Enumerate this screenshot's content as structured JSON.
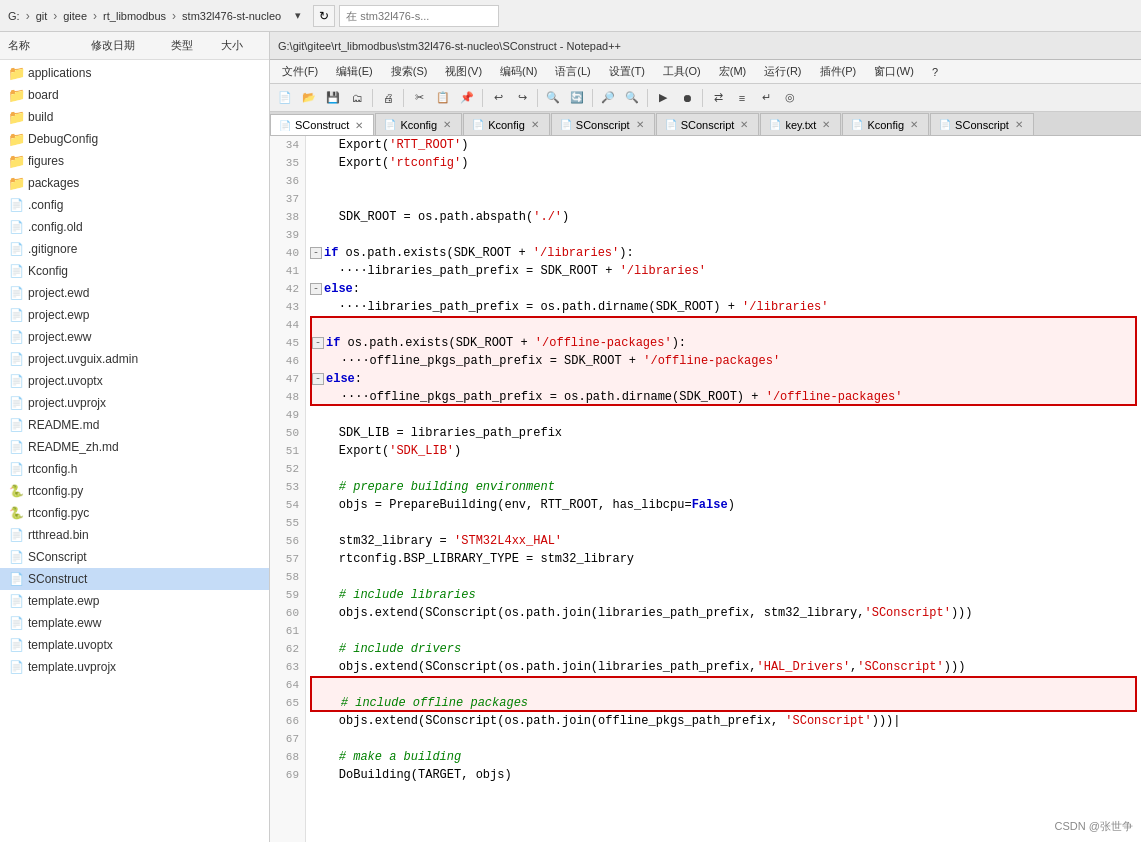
{
  "address_bar": {
    "parts": [
      "G:",
      "git",
      "gitee",
      "rt_libmodbus",
      "stm32l476-st-nucleo"
    ],
    "search_placeholder": "在 stm32l476-s..."
  },
  "sidebar": {
    "columns": [
      "名称",
      "修改日期",
      "类型",
      "大小"
    ],
    "items": [
      {
        "name": "applications",
        "type": "folder",
        "selected": false
      },
      {
        "name": "board",
        "type": "folder",
        "selected": false
      },
      {
        "name": "build",
        "type": "folder",
        "selected": false
      },
      {
        "name": "DebugConfig",
        "type": "folder",
        "selected": false
      },
      {
        "name": "figures",
        "type": "folder",
        "selected": false
      },
      {
        "name": "packages",
        "type": "folder",
        "selected": false
      },
      {
        "name": ".config",
        "type": "file-dot",
        "selected": false
      },
      {
        "name": ".config.old",
        "type": "file-dot",
        "selected": false
      },
      {
        "name": ".gitignore",
        "type": "file-dot",
        "selected": false
      },
      {
        "name": "Kconfig",
        "type": "file-green",
        "selected": false
      },
      {
        "name": "project.ewd",
        "type": "file-plain",
        "selected": false
      },
      {
        "name": "project.ewp",
        "type": "file-plain",
        "selected": false
      },
      {
        "name": "project.eww",
        "type": "file-plain",
        "selected": false
      },
      {
        "name": "project.uvguix.admin",
        "type": "file-plain",
        "selected": false
      },
      {
        "name": "project.uvoptx",
        "type": "file-plain",
        "selected": false
      },
      {
        "name": "project.uvprojx",
        "type": "file-uvision",
        "selected": false
      },
      {
        "name": "README.md",
        "type": "file-plain",
        "selected": false
      },
      {
        "name": "README_zh.md",
        "type": "file-plain",
        "selected": false
      },
      {
        "name": "rtconfig.h",
        "type": "file-plain",
        "selected": false
      },
      {
        "name": "rtconfig.py",
        "type": "file-py",
        "selected": false
      },
      {
        "name": "rtconfig.pyc",
        "type": "file-py",
        "selected": false
      },
      {
        "name": "rtthread.bin",
        "type": "file-plain",
        "selected": false
      },
      {
        "name": "SConscript",
        "type": "file-plain",
        "selected": false
      },
      {
        "name": "SConstruct",
        "type": "file-plain",
        "selected": true
      },
      {
        "name": "template.ewp",
        "type": "file-plain",
        "selected": false
      },
      {
        "name": "template.eww",
        "type": "file-plain",
        "selected": false
      },
      {
        "name": "template.uvoptx",
        "type": "file-plain",
        "selected": false
      },
      {
        "name": "template.uvprojx",
        "type": "file-uvision",
        "selected": false
      }
    ]
  },
  "editor": {
    "title": "G:\\git\\gitee\\rt_libmodbus\\stm32l476-st-nucleo\\SConstruct - Notepad++",
    "menus": [
      "文件(F)",
      "编辑(E)",
      "搜索(S)",
      "视图(V)",
      "编码(N)",
      "语言(L)",
      "设置(T)",
      "工具(O)",
      "宏(M)",
      "运行(R)",
      "插件(P)",
      "窗口(W)",
      "?"
    ],
    "tabs": [
      {
        "label": "SConstruct",
        "active": true,
        "has_dot": false
      },
      {
        "label": "Kconfig",
        "active": false,
        "has_dot": false
      },
      {
        "label": "Kconfig",
        "active": false,
        "has_dot": false
      },
      {
        "label": "SConscript",
        "active": false,
        "has_dot": false
      },
      {
        "label": "SConscript",
        "active": false,
        "has_dot": false
      },
      {
        "label": "key.txt",
        "active": false,
        "has_dot": false
      },
      {
        "label": "Kconfig",
        "active": false,
        "has_dot": false
      },
      {
        "label": "SConscript",
        "active": false,
        "has_dot": false
      }
    ],
    "lines": [
      {
        "num": 34,
        "text": "    Export('RTT_ROOT')",
        "highlight": false
      },
      {
        "num": 35,
        "text": "    Export('rtconfig')",
        "highlight": false
      },
      {
        "num": 36,
        "text": "",
        "highlight": false
      },
      {
        "num": 37,
        "text": "",
        "highlight": false
      },
      {
        "num": 38,
        "text": "    SDK_ROOT = os.path.abspath('./')",
        "highlight": false
      },
      {
        "num": 39,
        "text": "",
        "highlight": false
      },
      {
        "num": 40,
        "text": "[-]if os.path.exists(SDK_ROOT + '/libraries'):",
        "highlight": false
      },
      {
        "num": 41,
        "text": "    ····libraries_path_prefix = SDK_ROOT + '/libraries'",
        "highlight": false
      },
      {
        "num": 42,
        "text": "[-]else:",
        "highlight": false
      },
      {
        "num": 43,
        "text": "    ····libraries_path_prefix = os.path.dirname(SDK_ROOT) + '/libraries'",
        "highlight": false
      },
      {
        "num": 44,
        "text": "",
        "highlight": false
      },
      {
        "num": 45,
        "text": "[-]if os.path.exists(SDK_ROOT + '/offline-packages'):",
        "highlight": true,
        "box_start": true
      },
      {
        "num": 46,
        "text": "    ····offline_pkgs_path_prefix = SDK_ROOT + '/offline-packages'",
        "highlight": true
      },
      {
        "num": 47,
        "text": "[-]else:",
        "highlight": true
      },
      {
        "num": 48,
        "text": "    ····offline_pkgs_path_prefix = os.path.dirname(SDK_ROOT) + '/offline-packages'",
        "highlight": true,
        "box_end": true
      },
      {
        "num": 49,
        "text": "",
        "highlight": false
      },
      {
        "num": 50,
        "text": "    SDK_LIB = libraries_path_prefix",
        "highlight": false
      },
      {
        "num": 51,
        "text": "    Export('SDK_LIB')",
        "highlight": false
      },
      {
        "num": 52,
        "text": "",
        "highlight": false
      },
      {
        "num": 53,
        "text": "    # prepare building environment",
        "highlight": false,
        "is_comment": true
      },
      {
        "num": 54,
        "text": "    objs = PrepareBuilding(env, RTT_ROOT, has_libcpu=False)",
        "highlight": false
      },
      {
        "num": 55,
        "text": "",
        "highlight": false
      },
      {
        "num": 56,
        "text": "    stm32_library = 'STM32L4xx_HAL'",
        "highlight": false
      },
      {
        "num": 57,
        "text": "    rtconfig.BSP_LIBRARY_TYPE = stm32_library",
        "highlight": false
      },
      {
        "num": 58,
        "text": "",
        "highlight": false
      },
      {
        "num": 59,
        "text": "    # include libraries",
        "highlight": false,
        "is_comment": true
      },
      {
        "num": 60,
        "text": "    objs.extend(SConscript(os.path.join(libraries_path_prefix, stm32_library,'SConscript')))",
        "highlight": false
      },
      {
        "num": 61,
        "text": "",
        "highlight": false
      },
      {
        "num": 62,
        "text": "    # include drivers",
        "highlight": false,
        "is_comment": true
      },
      {
        "num": 63,
        "text": "    objs.extend(SConscript(os.path.join(libraries_path_prefix,'HAL_Drivers','SConscript')))",
        "highlight": false
      },
      {
        "num": 64,
        "text": "",
        "highlight": false
      },
      {
        "num": 65,
        "text": "    # include offline packages",
        "highlight": true,
        "is_comment": true,
        "box_bottom_start": true
      },
      {
        "num": 66,
        "text": "    objs.extend(SConscript(os.path.join(offline_pkgs_path_prefix, 'SConscript')))|",
        "highlight": true,
        "box_bottom_end": true
      },
      {
        "num": 67,
        "text": "",
        "highlight": false
      },
      {
        "num": 68,
        "text": "    # make a building",
        "highlight": false,
        "is_comment": true
      },
      {
        "num": 69,
        "text": "    DoBuilding(TARGET, objs)",
        "highlight": false
      }
    ]
  },
  "watermark": "CSDN @张世争"
}
